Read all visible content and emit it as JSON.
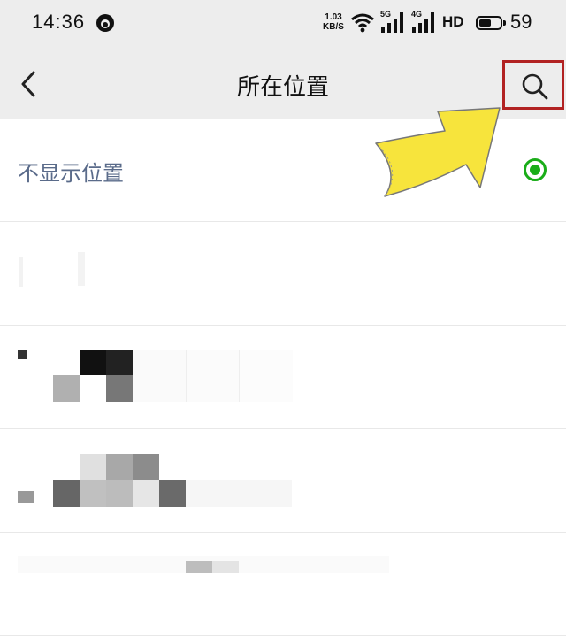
{
  "status_bar": {
    "time": "14:36",
    "net_speed_value": "1.03",
    "net_speed_unit": "KB/S",
    "signal1_label": "5G",
    "signal2_label": "4G",
    "hd_label": "HD",
    "battery_level": 59,
    "battery_text": "59"
  },
  "nav": {
    "title": "所在位置"
  },
  "list": {
    "hide_location_label": "不显示位置",
    "selected_option": "hide_location"
  },
  "colors": {
    "accent_green": "#1aad19",
    "highlight_red": "#b22222",
    "arrow_yellow": "#f7e43c",
    "label_blue_gray": "#5a6b8a"
  }
}
